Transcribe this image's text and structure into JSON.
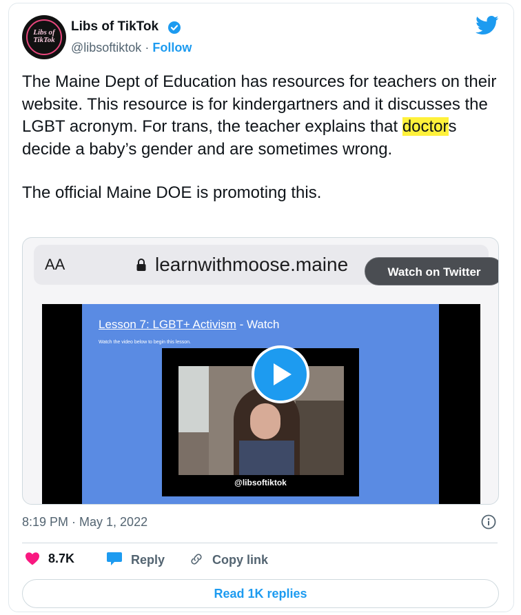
{
  "author": {
    "name": "Libs of TikTok",
    "handle": "@libsoftiktok",
    "separator": "·",
    "follow_label": "Follow",
    "avatar_text_line1": "Libs of",
    "avatar_text_line2": "TikTok",
    "verified": true
  },
  "icons": {
    "twitter": "twitter-bird-icon",
    "verified": "verified-badge-icon",
    "lock": "lock-icon",
    "play": "play-icon",
    "info": "info-icon",
    "like": "heart-icon",
    "reply": "reply-bubble-icon",
    "copy": "link-icon"
  },
  "tweet": {
    "para1_before": "The Maine Dept of Education has resources for teachers on their website. This resource is for kindergartners and it discusses the LGBT acronym. For trans, the teacher explains that ",
    "para1_highlight": "doctor",
    "para1_after": "s decide a baby’s gender and are sometimes wrong.",
    "para2": "The official Maine DOE is promoting this."
  },
  "media": {
    "browser_aa": "AA",
    "url": "learnwithmoose.maine",
    "watch_label": "Watch on Twitter",
    "lesson_title": "Lesson 7: LGBT+ Activism",
    "lesson_suffix": " - Watch",
    "lesson_sub": "Watch the video below to begin this lesson.",
    "watermark": "@libsoftiktok"
  },
  "meta": {
    "timestamp": "8:19 PM · May 1, 2022"
  },
  "actions": {
    "likes": "8.7K",
    "reply_label": "Reply",
    "copy_label": "Copy link"
  },
  "read_replies_label": "Read 1K replies",
  "colors": {
    "accent": "#1d9bf0",
    "like": "#f91880",
    "highlight": "#fff13b",
    "slide_bg": "#5a8be3"
  }
}
